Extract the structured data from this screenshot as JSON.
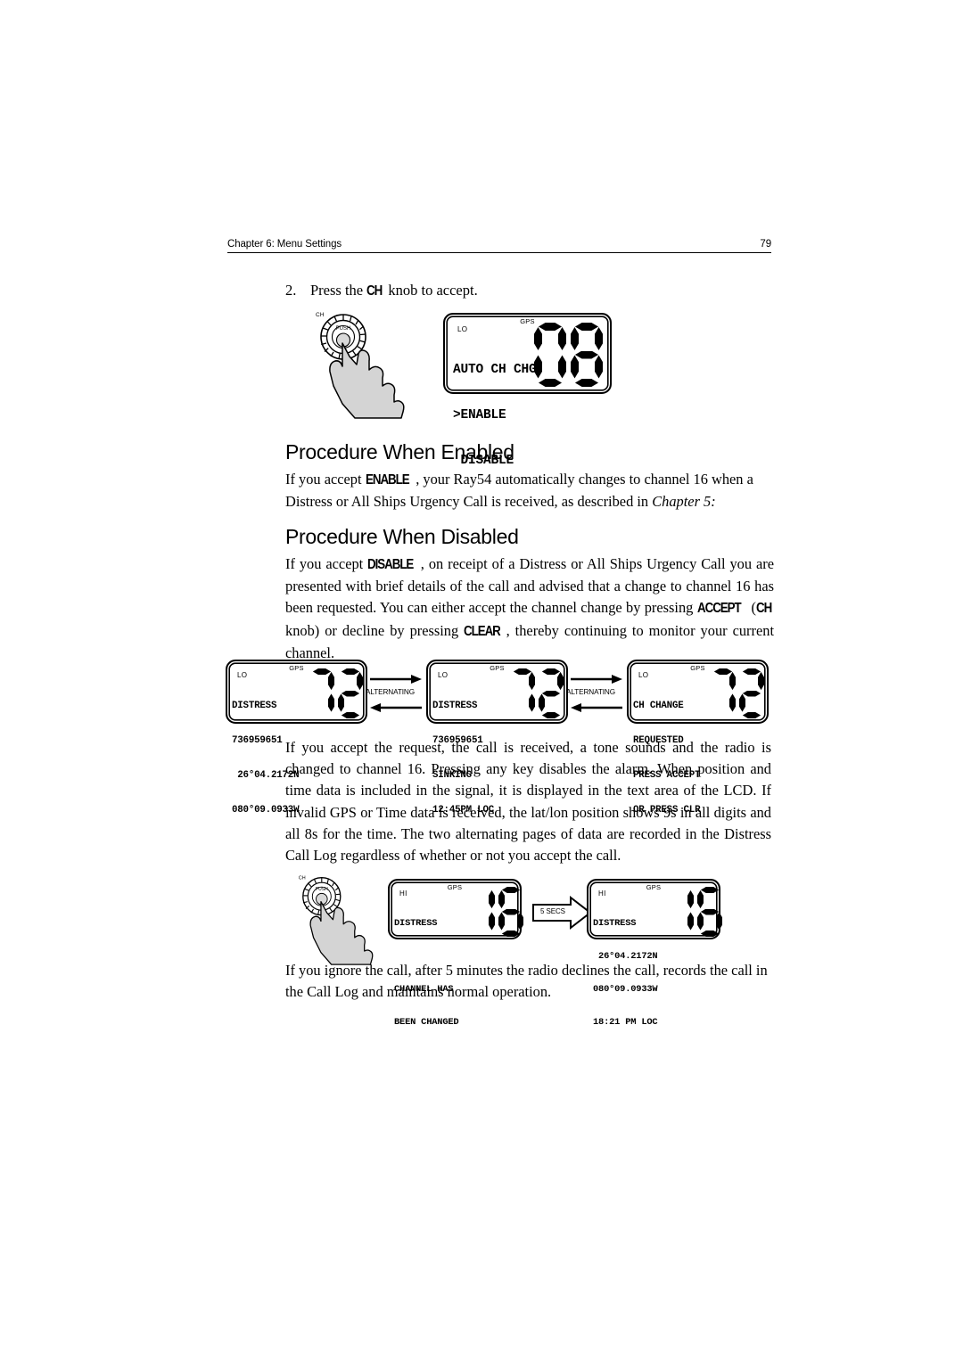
{
  "header": {
    "chapter": "Chapter 6: Menu Settings",
    "page_number": "79"
  },
  "step": {
    "number": "2.",
    "text_before": "Press the ",
    "control": "CH",
    "text_after": " knob to accept."
  },
  "sections": {
    "enabled": {
      "heading": "Procedure When Enabled",
      "paragraph_1": "If you accept ",
      "term_1": "ENABLE",
      "paragraph_2": ", your Ray54 automatically changes to channel 16 when a Distress or All Ships Urgency Call is received, as described in ",
      "italic_ref": "Chapter 5:"
    },
    "disabled": {
      "heading": "Procedure When Disabled",
      "p_a": "If you accept ",
      "term_disable": "DISABLE",
      "p_b": ", on receipt of a Distress or All Ships Urgency Call you are presented with brief details of the call and advised that a change to channel 16 has been requested. You can either accept the channel change by pressing ",
      "term_accept": "ACCEPT",
      "p_c": " (",
      "term_ch": "CH",
      "p_d": " knob) or decline by pressing ",
      "term_clear": "CLEAR",
      "p_e": ", thereby continuing to monitor your current channel."
    },
    "accept_para": "If you accept the request, the call is received, a tone sounds and the radio is changed to channel 16. Pressing any key disables the alarm. When position and time data is included in the signal, it is displayed in the text area of the LCD. If invalid GPS or Time data is received, the lat/lon position shows 9s in all digits and all 8s for the time. The two alternating pages of data are recorded in the Distress Call Log regardless of whether or not you accept the call.",
    "ignore_para": "If you ignore the call, after 5 minutes the radio declines the call, records the call in the Call Log and maintains normal operation."
  },
  "knobs": {
    "label_ch": "CH",
    "label_push": "PUSH"
  },
  "lcds": {
    "menu": {
      "gps": "GPS",
      "power": "LO",
      "lines": [
        "AUTO CH CHG",
        ">ENABLE",
        " DISABLE"
      ],
      "channel": "08"
    },
    "distress_pos": {
      "gps": "GPS",
      "power": "LO",
      "lines": [
        "DISTRESS",
        "736959651",
        " 26°04.2172N",
        "080°09.0933W"
      ],
      "channel": "72"
    },
    "distress_nature": {
      "gps": "GPS",
      "power": "LO",
      "lines": [
        "DISTRESS",
        "736959651",
        "SINKING",
        "12:45PM LOC"
      ],
      "channel": "72"
    },
    "ch_change": {
      "gps": "GPS",
      "power": "LO",
      "lines": [
        "CH CHANGE",
        "REQUESTED",
        "PRESS ACCEPT",
        "OR PRESS CLR"
      ],
      "channel": "72"
    },
    "changed": {
      "gps": "GPS",
      "power": "HI",
      "lines": [
        "DISTRESS",
        "",
        "CHANNEL HAS",
        "BEEN CHANGED"
      ],
      "channel": "16"
    },
    "changed_pos": {
      "gps": "GPS",
      "power": "HI",
      "lines": [
        "DISTRESS",
        " 26°04.2172N",
        "080°09.0933W",
        "18:21 PM LOC"
      ],
      "channel": "16"
    }
  },
  "annotations": {
    "alternating_1": "ALTERNATING",
    "alternating_2": "ALTERNATING",
    "five_secs": "5 SECS"
  }
}
